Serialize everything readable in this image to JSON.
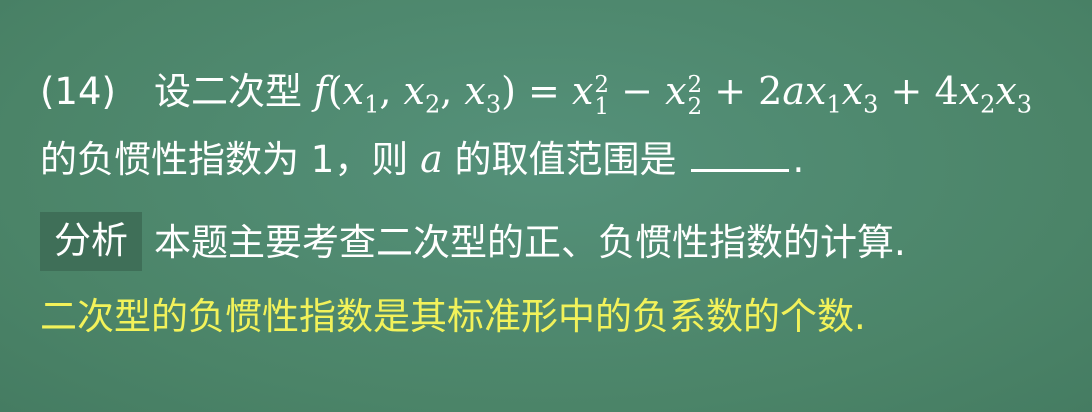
{
  "problem": {
    "number": "(14)",
    "intro": "设二次型",
    "func_name": "f",
    "func_args": "(x₁, x₂, x₃)",
    "equals": "=",
    "expr": "x₁² − x₂² + 2ax₁x₃ + 4x₂x₃",
    "line2_a": "的负惯性指数为",
    "value": "1",
    "comma_then": "，则",
    "var": "a",
    "line2_b": "的取值范围是",
    "end": "."
  },
  "analysis": {
    "tag": "分析",
    "text": "本题主要考查二次型的正、负惯性指数的计算."
  },
  "note": {
    "text": "二次型的负惯性指数是其标准形中的负系数的个数."
  },
  "colors": {
    "background": "#4f8a70",
    "text": "#ffffff",
    "highlight": "#f2f25a",
    "tag_bg": "#3f6f58"
  }
}
